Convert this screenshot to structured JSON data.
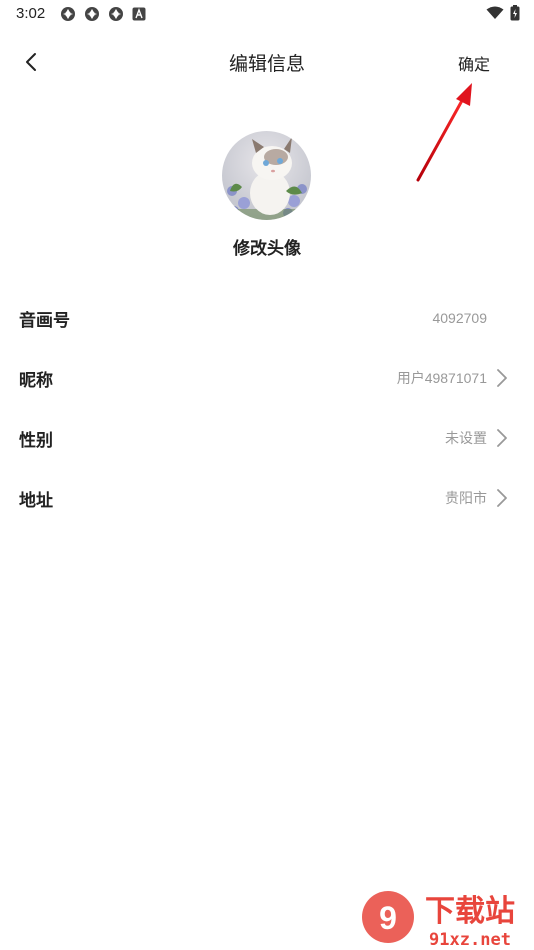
{
  "status_bar": {
    "time": "3:02",
    "left_icons": [
      "app-notification-icon",
      "app-notification-icon",
      "app-notification-icon",
      "a-badge-icon"
    ],
    "right_icons": [
      "wifi-icon",
      "battery-icon"
    ]
  },
  "nav": {
    "title": "编辑信息",
    "confirm_label": "确定",
    "back_icon": "chevron-left-icon"
  },
  "profile": {
    "avatar_alt": "avatar",
    "change_avatar_label": "修改头像"
  },
  "rows": [
    {
      "label": "音画号",
      "value": "4092709",
      "has_chevron": false
    },
    {
      "label": "昵称",
      "value": "用户49871071",
      "has_chevron": true
    },
    {
      "label": "性别",
      "value": "未设置",
      "has_chevron": true
    },
    {
      "label": "地址",
      "value": "贵阳市",
      "has_chevron": true
    }
  ],
  "watermark": {
    "main": "下载站",
    "domain": "91xz.net"
  },
  "colors": {
    "annotation_arrow": "#e0141e",
    "value_text": "#999999",
    "watermark_red": "#e8453c"
  }
}
